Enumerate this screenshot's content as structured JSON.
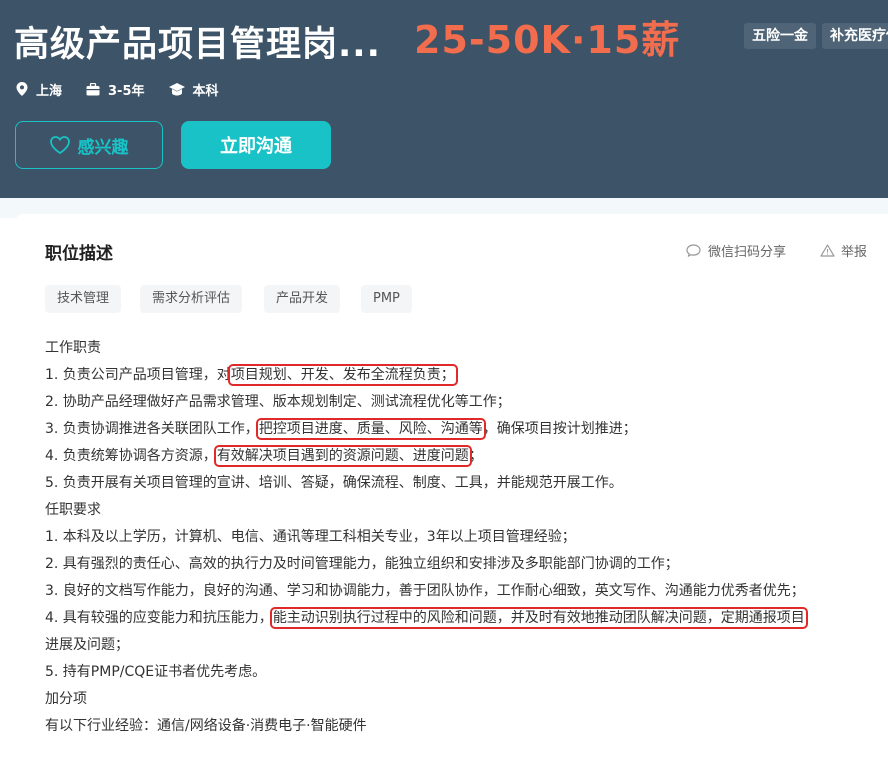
{
  "job": {
    "title": "高级产品项目管理岗...",
    "salary": "25-50K·15薪",
    "benefits": [
      "五险一金",
      "补充医疗保"
    ],
    "meta": {
      "location": "上海",
      "experience": "3-5年",
      "education": "本科"
    }
  },
  "actions": {
    "interest_label": "感兴趣",
    "chat_label": "立即沟通"
  },
  "section": {
    "title": "职位描述",
    "share_label": "微信扫码分享",
    "report_label": "举报"
  },
  "tags": [
    "技术管理",
    "需求分析评估",
    "产品开发",
    "PMP"
  ],
  "description": {
    "duties_heading": "工作职责",
    "duty1_pre": "1. 负责公司产品项目管理，对",
    "duty1_hl": "项目规划、开发、发布全流程负责；",
    "duty2": "2. 协助产品经理做好产品需求管理、版本规划制定、测试流程优化等工作；",
    "duty3_pre": "3. 负责协调推进各关联团队工作，",
    "duty3_hl": "把控项目进度、质量、风险、沟通等",
    "duty3_post": "，确保项目按计划推进；",
    "duty4_pre": "4. 负责统筹协调各方资源，",
    "duty4_hl": "有效解决项目遇到的资源问题、进度问题",
    "duty4_post": "；",
    "duty5": "5. 负责开展有关项目管理的宣讲、培训、答疑，确保流程、制度、工具，并能规范开展工作。",
    "req_heading": "任职要求",
    "req1": "1. 本科及以上学历，计算机、电信、通讯等理工科相关专业，3年以上项目管理经验；",
    "req2": "2. 具有强烈的责任心、高效的执行力及时间管理能力，能独立组织和安排涉及多职能部门协调的工作；",
    "req3": "3. 良好的文档写作能力，良好的沟通、学习和协调能力，善于团队协作，工作耐心细致，英文写作、沟通能力优秀者优先；",
    "req4_pre": "4. 具有较强的应变能力和抗压能力，",
    "req4_hl": "能主动识别执行过程中的风险和问题，并及时有效地推动团队解决问题，定期通报项目",
    "req4_cont": "进展及问题；",
    "req5": "5. 持有PMP/CQE证书者优先考虑。",
    "bonus_heading": "加分项",
    "bonus1": "有以下行业经验：通信/网络设备·消费电子·智能硬件"
  },
  "colors": {
    "header_bg": "#3d5367",
    "salary": "#f26d4e",
    "accent": "#19c2c6",
    "highlight_box": "#e02a2a"
  },
  "icons": [
    "location-icon",
    "briefcase-icon",
    "graduation-cap-icon",
    "heart-icon",
    "wechat-icon",
    "warning-icon"
  ]
}
